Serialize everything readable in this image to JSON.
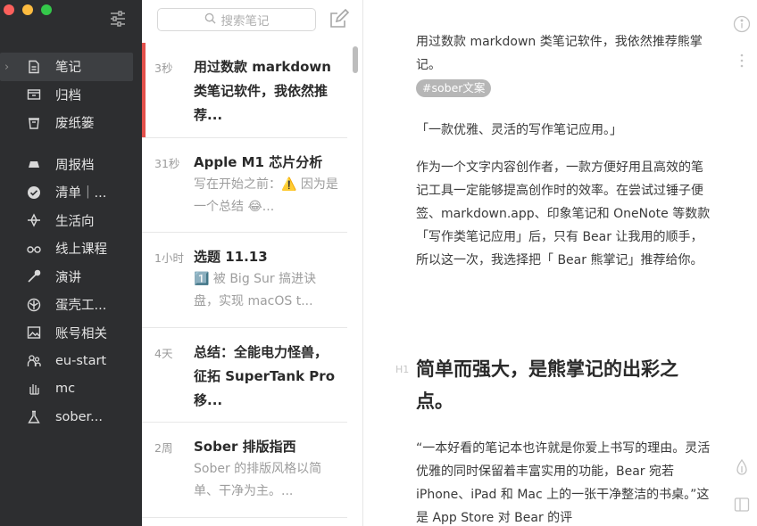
{
  "sidebar": {
    "items": [
      {
        "label": "笔记",
        "icon": "note-icon"
      },
      {
        "label": "归档",
        "icon": "archive-icon"
      },
      {
        "label": "废纸篓",
        "icon": "trash-icon"
      },
      {
        "label": "周报档",
        "icon": "hat-icon"
      },
      {
        "label": "清单｜...",
        "icon": "check-circle-icon"
      },
      {
        "label": "生活向",
        "icon": "sparkle-icon"
      },
      {
        "label": "线上课程",
        "icon": "glasses-icon"
      },
      {
        "label": "演讲",
        "icon": "mic-icon"
      },
      {
        "label": "蛋壳工...",
        "icon": "shield-icon"
      },
      {
        "label": "账号相关",
        "icon": "image-icon"
      },
      {
        "label": "eu-start",
        "icon": "people-icon"
      },
      {
        "label": "mc",
        "icon": "hand-icon"
      },
      {
        "label": "sober...",
        "icon": "flask-icon"
      }
    ]
  },
  "list": {
    "search_placeholder": "搜索笔记",
    "notes": [
      {
        "time": "3秒",
        "title": "用过数款 markdown 类笔记软件，我依然推荐...",
        "snippet": ""
      },
      {
        "time": "31秒",
        "title": "Apple M1 芯片分析",
        "snippet": "写在开始之前：⚠️ 因为是一个总结 😂..."
      },
      {
        "time": "1小时",
        "title": "选题 11.13",
        "snippet": "1️⃣ 被 Big Sur 搞进诀盘，实现 macOS t..."
      },
      {
        "time": "4天",
        "title": "总结：全能电力怪兽，征拓 SuperTank Pro 移...",
        "snippet": ""
      },
      {
        "time": "2周",
        "title": "Sober 排版指西",
        "snippet": "Sober 的排版风格以简单、干净为主。..."
      }
    ]
  },
  "editor": {
    "intro": "用过数款 markdown 类笔记软件，我依然推荐熊掌记。",
    "tag": "#sober文案",
    "quote": "「一款优雅、灵活的写作笔记应用。」",
    "para1": "作为一个文字内容创作者，一款方便好用且高效的笔记工具一定能够提高创作时的效率。在尝试过锤子便签、markdown.app、印象笔记和 OneNote 等数款「写作类笔记应用」后，只有 Bear 让我用的顺手，所以这一次，我选择把「 Bear 熊掌记」推荐给你。",
    "h1_marker": "H1",
    "heading": "简单而强大，是熊掌记的出彩之点。",
    "para2": "“一本好看的笔记本也许就是你爱上书写的理由。灵活优雅的同时保留着丰富实用的功能，Bear 宛若 iPhone、iPad 和 Mac 上的一张干净整洁的书桌。”这是 App Store 对 Bear 的评"
  },
  "colors": {
    "sidebar_bg": "#2d2e30",
    "accent": "#e3504b",
    "tag_bg": "#b6b6b6"
  }
}
